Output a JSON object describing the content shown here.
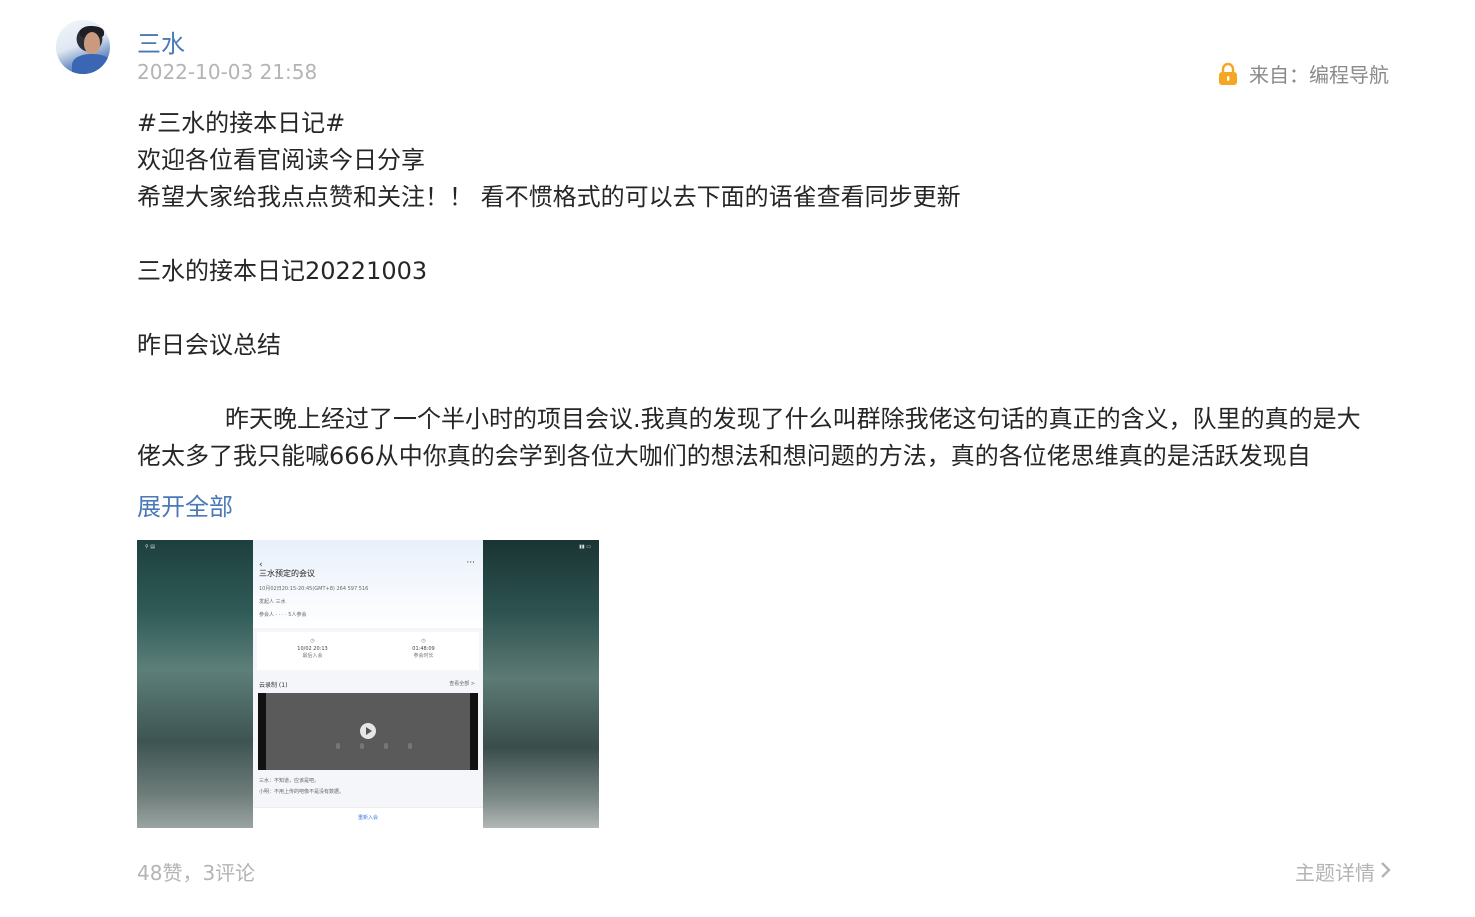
{
  "author": {
    "name": "三水",
    "timestamp": "2022-10-03 21:58"
  },
  "source": {
    "icon": "lock-icon",
    "text": "来自：编程导航",
    "accent": "#f5a623"
  },
  "post": {
    "lines": [
      "#三水的接本日记#",
      "欢迎各位看官阅读今日分享",
      "希望大家给我点点赞和关注！！ 看不惯格式的可以去下面的语雀查看同步更新"
    ],
    "heading": "三水的接本日记20221003",
    "subheading": "昨日会议总结",
    "paragraph": "昨天晚上经过了一个半小时的项目会议.我真的发现了什么叫群除我佬这句话的真正的含义，队里的真的是大佬太多了我只能喊666从中你真的会学到各位大咖们的想法和想问题的方法，真的各位佬思维真的是活跃发现自"
  },
  "expand_label": "展开全部",
  "attachment": {
    "meeting_title": "三水预定的会议",
    "meeting_time": "10月02日20:15-20:45(GMT+8)   264 597 516",
    "host_label": "发起人  三水",
    "participants_label": "参会人  ·  ·  ·  ·  5人参会",
    "stat_start_time": "10/02 20:13",
    "stat_start_label": "最后入会",
    "stat_duration": "01:48:09",
    "stat_duration_label": "参会时长",
    "recording_label": "云录制 (1)",
    "recording_more": "查看全部 >",
    "note_1": "三水：不知道，应该是吧。",
    "note_2": "小明：不用上传的吧像不是没有数据。",
    "rejoin_label": "重新入会"
  },
  "footer": {
    "stats": "48赞，3评论",
    "detail_label": "主题详情"
  },
  "colors": {
    "link": "#4a79b8",
    "muted": "#b4b4b4"
  }
}
